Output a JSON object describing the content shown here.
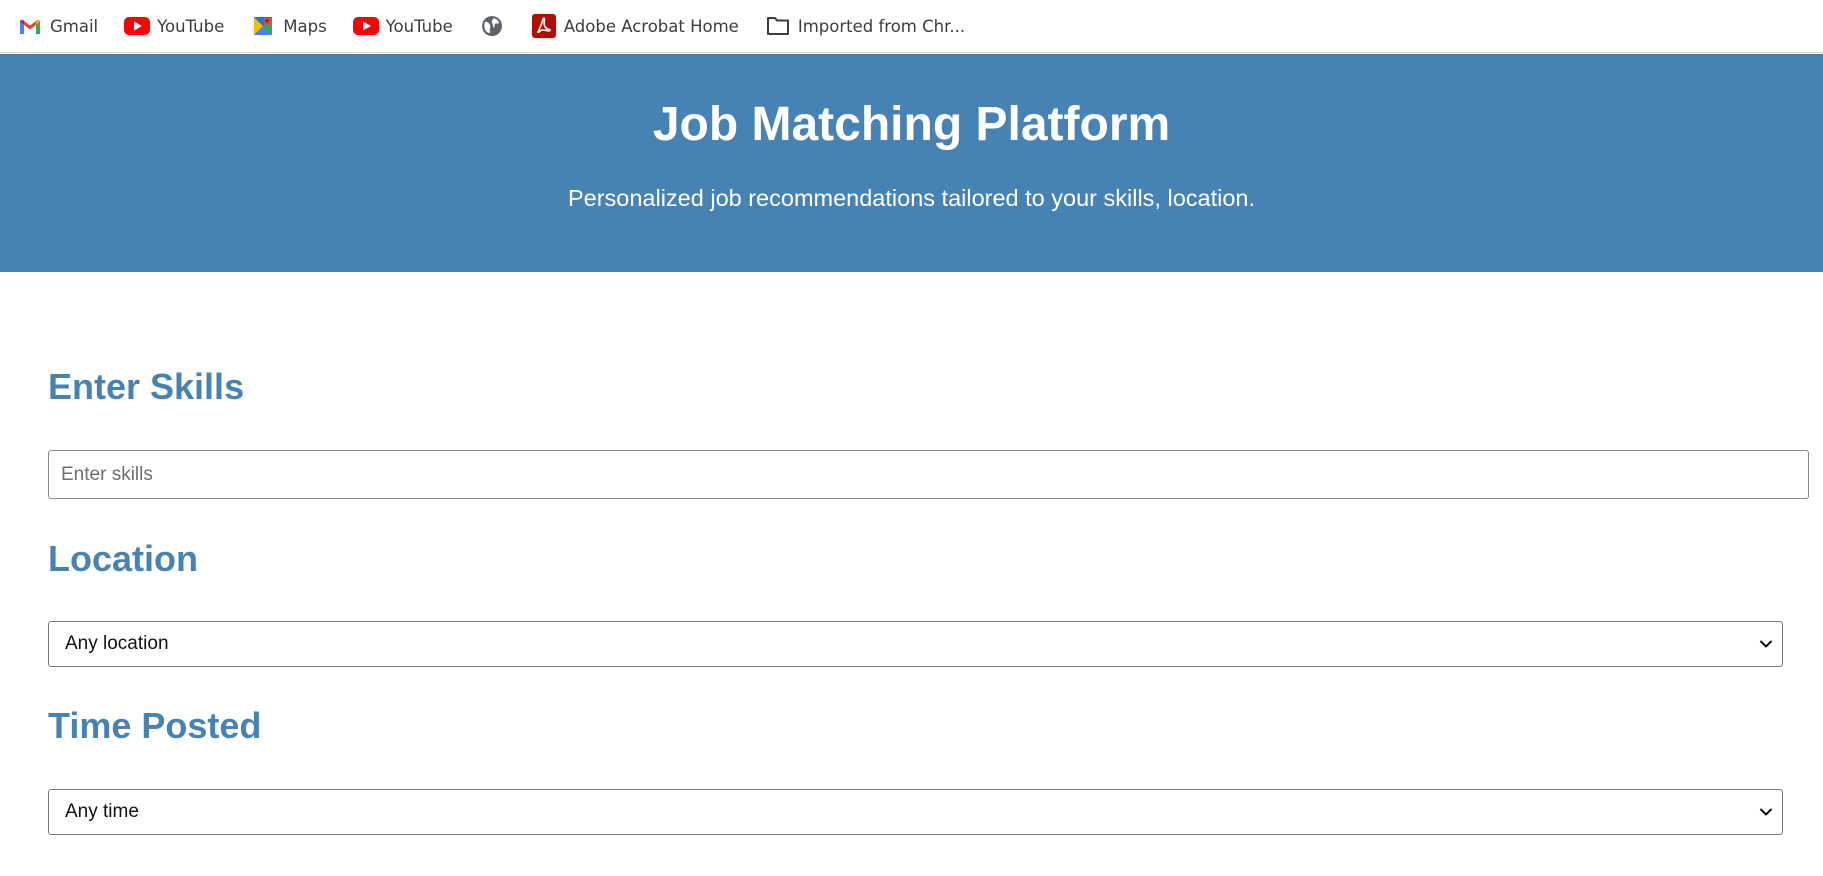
{
  "bookmarks": [
    {
      "label": "Gmail",
      "icon": "gmail-icon"
    },
    {
      "label": "YouTube",
      "icon": "youtube-icon"
    },
    {
      "label": "Maps",
      "icon": "maps-icon"
    },
    {
      "label": "YouTube",
      "icon": "youtube-icon"
    },
    {
      "label": "",
      "icon": "globe-icon"
    },
    {
      "label": "Adobe Acrobat Home",
      "icon": "acrobat-icon"
    },
    {
      "label": "Imported from Chr...",
      "icon": "folder-icon"
    }
  ],
  "hero": {
    "title": "Job Matching Platform",
    "subtitle": "Personalized job recommendations tailored to your skills, location."
  },
  "skills": {
    "heading": "Enter Skills",
    "placeholder": "Enter skills",
    "value": ""
  },
  "location": {
    "heading": "Location",
    "selected": "Any location"
  },
  "time_posted": {
    "heading": "Time Posted",
    "selected": "Any time"
  },
  "colors": {
    "accent": "#4682b4",
    "youtube_red": "#ff0000",
    "acrobat_red": "#b30b00"
  }
}
